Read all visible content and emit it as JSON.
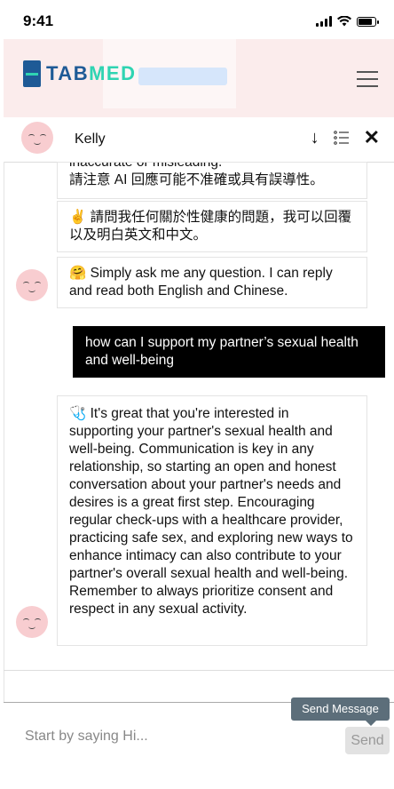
{
  "status_bar": {
    "time": "9:41"
  },
  "brand": {
    "name_part1": "TAB",
    "name_part2": "MED"
  },
  "chat": {
    "agent_name": "Kelly",
    "messages": [
      {
        "sender": "bot",
        "cut_line": "inaccurate or misleading.",
        "text": "請注意 AI 回應可能不准確或具有誤導性。"
      },
      {
        "sender": "bot",
        "emoji": "✌️",
        "text": "請問我任何關於性健康的問題，我可以回覆以及明白英文和中文。"
      },
      {
        "sender": "bot",
        "emoji": "🤗",
        "text": "Simply ask me any question. I can reply and read both English and Chinese."
      },
      {
        "sender": "user",
        "text": "how can I support my partner’s sexual health and well-being"
      },
      {
        "sender": "bot",
        "emoji": "🩺",
        "text": "It's great that you're interested in supporting your partner's sexual health and well-being. Communication is key in any relationship, so starting an open and honest conversation about your partner's needs and desires is a great first step. Encouraging regular check-ups with a healthcare provider, practicing safe sex, and exploring new ways to enhance intimacy can also contribute to your partner's overall sexual health and well-being. Remember to always prioritize consent and respect in any sexual activity."
      }
    ]
  },
  "input": {
    "placeholder": "Start by saying Hi...",
    "send_label": "Send",
    "tooltip": "Send Message"
  },
  "icons": {
    "download": "down-arrow-icon",
    "list": "list-icon",
    "close": "close-icon",
    "menu": "hamburger-menu-icon"
  },
  "colors": {
    "brand_blue": "#1e5a96",
    "brand_teal": "#2fd4b2",
    "header_bg": "#fbecec",
    "user_bubble": "#000000",
    "tooltip_bg": "#5c6e7a"
  }
}
